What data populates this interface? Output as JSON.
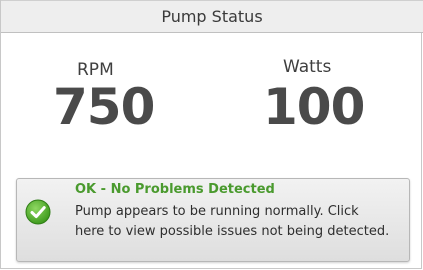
{
  "header": {
    "title": "Pump Status"
  },
  "metrics": {
    "rpm": {
      "label": "RPM",
      "value": "750"
    },
    "watts": {
      "label": "Watts",
      "value": "100"
    }
  },
  "status": {
    "icon": "check-circle-icon",
    "title": "OK - No Problems Detected",
    "message_line1": "Pump appears to be running normally. Click",
    "message_line2": "here to view possible issues not being detected.",
    "colors": {
      "title": "#4a9a2e",
      "icon": "#5cb531"
    }
  }
}
